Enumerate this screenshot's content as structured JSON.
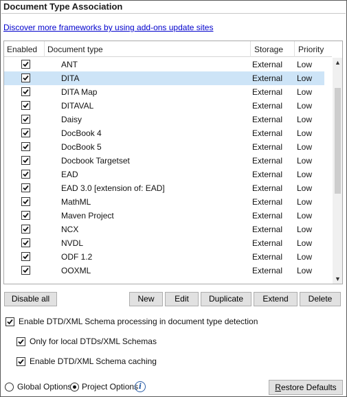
{
  "title": "Document Type Association",
  "link_text": "Discover more frameworks by using add-ons update sites",
  "table": {
    "columns": [
      "Enabled",
      "Document type",
      "Storage",
      "Priority"
    ],
    "rows": [
      {
        "type": "ANT",
        "storage": "External",
        "priority": "Low",
        "enabled": true
      },
      {
        "type": "DITA",
        "storage": "External",
        "priority": "Low",
        "enabled": true,
        "selected": true
      },
      {
        "type": "DITA Map",
        "storage": "External",
        "priority": "Low",
        "enabled": true
      },
      {
        "type": "DITAVAL",
        "storage": "External",
        "priority": "Low",
        "enabled": true
      },
      {
        "type": "Daisy",
        "storage": "External",
        "priority": "Low",
        "enabled": true
      },
      {
        "type": "DocBook 4",
        "storage": "External",
        "priority": "Low",
        "enabled": true
      },
      {
        "type": "DocBook 5",
        "storage": "External",
        "priority": "Low",
        "enabled": true
      },
      {
        "type": "Docbook Targetset",
        "storage": "External",
        "priority": "Low",
        "enabled": true
      },
      {
        "type": "EAD",
        "storage": "External",
        "priority": "Low",
        "enabled": true
      },
      {
        "type": "EAD 3.0 [extension of: EAD]",
        "storage": "External",
        "priority": "Low",
        "enabled": true
      },
      {
        "type": "MathML",
        "storage": "External",
        "priority": "Low",
        "enabled": true
      },
      {
        "type": "Maven Project",
        "storage": "External",
        "priority": "Low",
        "enabled": true
      },
      {
        "type": "NCX",
        "storage": "External",
        "priority": "Low",
        "enabled": true
      },
      {
        "type": "NVDL",
        "storage": "External",
        "priority": "Low",
        "enabled": true
      },
      {
        "type": "ODF 1.2",
        "storage": "External",
        "priority": "Low",
        "enabled": true
      },
      {
        "type": "OOXML",
        "storage": "External",
        "priority": "Low",
        "enabled": true
      }
    ]
  },
  "buttons": {
    "disable_all": "Disable all",
    "new": "New",
    "edit": "Edit",
    "duplicate": "Duplicate",
    "extend": "Extend",
    "delete": "Delete",
    "restore_defaults": "Restore Defaults"
  },
  "options": {
    "enable_dtd_detection": "Enable DTD/XML Schema processing in document type detection",
    "only_local": "Only for local DTDs/XML Schemas",
    "enable_caching": "Enable DTD/XML Schema caching"
  },
  "scope": {
    "global": "Global Options",
    "project": "Project Options",
    "selected": "project"
  }
}
